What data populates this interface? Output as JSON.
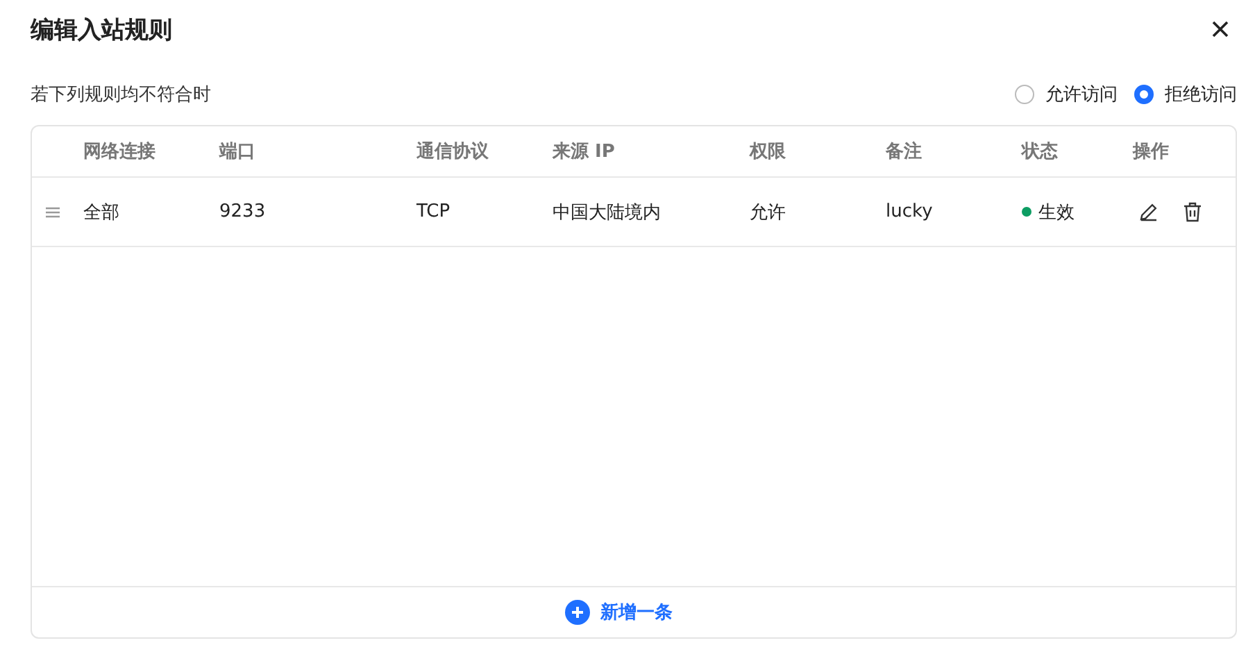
{
  "dialog": {
    "title": "编辑入站规则"
  },
  "default_rule": {
    "label": "若下列规则均不符合时",
    "options": [
      {
        "label": "允许访问",
        "selected": false
      },
      {
        "label": "拒绝访问",
        "selected": true
      }
    ]
  },
  "table": {
    "columns": [
      "网络连接",
      "端口",
      "通信协议",
      "来源 IP",
      "权限",
      "备注",
      "状态",
      "操作"
    ],
    "rows": [
      {
        "network": "全部",
        "port": "9233",
        "protocol": "TCP",
        "source_ip": "中国大陆境内",
        "permission": "允许",
        "note": "lucky",
        "status": {
          "label": "生效",
          "color": "#0d9d63"
        }
      }
    ]
  },
  "add_button": {
    "label": "新增一条"
  }
}
